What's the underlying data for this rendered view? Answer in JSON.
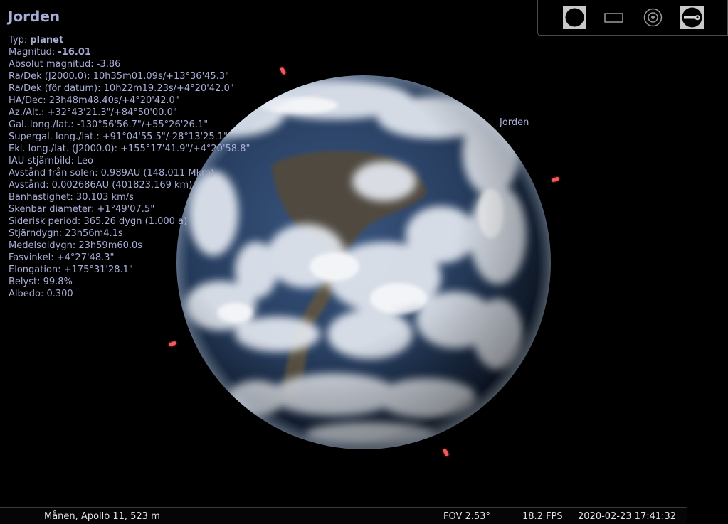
{
  "object": {
    "name": "Jorden",
    "label": "Jorden",
    "info": [
      {
        "label": "Typ: ",
        "value": "planet",
        "bold": true
      },
      {
        "label": "Magnitud: ",
        "value": "-16.01",
        "bold": true
      },
      {
        "label": "Absolut magnitud: ",
        "value": "-3.86"
      },
      {
        "label": "Ra/Dek (J2000.0): ",
        "value": "10h35m01.09s/+13°36'45.3\""
      },
      {
        "label": "Ra/Dek (för datum): ",
        "value": "10h22m19.23s/+4°20'42.0\""
      },
      {
        "label": "HA/Dec: ",
        "value": "23h48m48.40s/+4°20'42.0\""
      },
      {
        "label": "Az./Alt.: ",
        "value": "+32°43'21.3\"/+84°50'00.0\""
      },
      {
        "label": "Gal. long./lat.: ",
        "value": "-130°56'56.7\"/+55°26'26.1\""
      },
      {
        "label": "Supergal. long./lat.: ",
        "value": "+91°04'55.5\"/-28°13'25.1\""
      },
      {
        "label": "Ekl. long./lat. (J2000.0): ",
        "value": "+155°17'41.9\"/+4°20'58.8\""
      },
      {
        "label": "IAU-stjärnbild: ",
        "value": "Leo"
      },
      {
        "label": "Avstånd från solen: ",
        "value": "0.989AU (148.011 Mkm)"
      },
      {
        "label": "Avstånd: ",
        "value": "0.002686AU (401823.169 km)"
      },
      {
        "label": "Banhastighet: ",
        "value": "30.103 km/s"
      },
      {
        "label": "Skenbar diameter: ",
        "value": "+1°49'07.5\""
      },
      {
        "label": "Siderisk period: ",
        "value": "365.26 dygn (1.000 a)"
      },
      {
        "label": "Stjärndygn: ",
        "value": "23h56m4.1s"
      },
      {
        "label": "Medelsoldygn: ",
        "value": "23h59m60.0s"
      },
      {
        "label": "Fasvinkel: ",
        "value": "+4°27'48.3\""
      },
      {
        "label": "Elongation: ",
        "value": "+175°31'28.1\""
      },
      {
        "label": "Belyst: ",
        "value": "99.8%"
      },
      {
        "label": "Albedo: ",
        "value": "0.300"
      }
    ]
  },
  "toolbar": {
    "buttons": [
      {
        "name": "planet-view-button",
        "icon": "filled-circle-icon"
      },
      {
        "name": "frame-button",
        "icon": "rectangle-outline-icon"
      },
      {
        "name": "target-button",
        "icon": "concentric-circles-icon"
      },
      {
        "name": "telescope-button",
        "icon": "telescope-icon"
      }
    ]
  },
  "status": {
    "location": "Månen, Apollo 11, 523 m",
    "fov": "FOV 2.53°",
    "fps": "18.2 FPS",
    "datetime": "2020-02-23 17:41:32"
  },
  "colors": {
    "info_text": "#a9aed6",
    "marker": "#f05a5a",
    "status_text": "#e4e4e4"
  }
}
